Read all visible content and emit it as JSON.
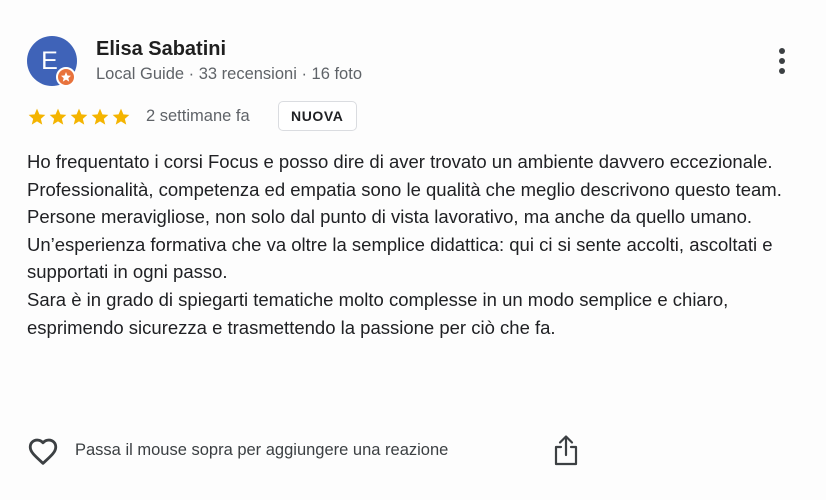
{
  "reviewer": {
    "initial": "E",
    "name": "Elisa Sabatini",
    "meta": "Local Guide · 33 recensioni · 16 foto",
    "avatar_color": "#3f63b8",
    "badge_color": "#e8733d"
  },
  "review": {
    "rating": 5,
    "max_rating": 5,
    "time": "2 settimane fa",
    "badge": "NUOVA",
    "paragraph_1": "Ho frequentato i corsi Focus e posso dire di aver trovato un ambiente davvero eccezionale. Professionalità, competenza ed empatia sono le qualità che meglio descrivono questo team. Persone meravigliose, non solo dal punto di vista lavorativo, ma anche da quello umano. Un’esperienza formativa che va oltre la semplice didattica: qui ci si sente accolti, ascoltati e supportati in ogni passo.",
    "paragraph_2": "Sara è in grado di spiegarti tematiche molto complesse in un modo semplice e chiaro, esprimendo sicurezza e trasmettendo la passione per ciò che fa."
  },
  "actions": {
    "reaction_label": "Passa il mouse sopra per aggiungere una reazione",
    "heart_icon": "heart-outline-icon",
    "share_icon": "share-icon",
    "more_icon": "more-vertical-icon"
  },
  "colors": {
    "star": "#f4b400",
    "secondary_text": "#5f6368"
  }
}
